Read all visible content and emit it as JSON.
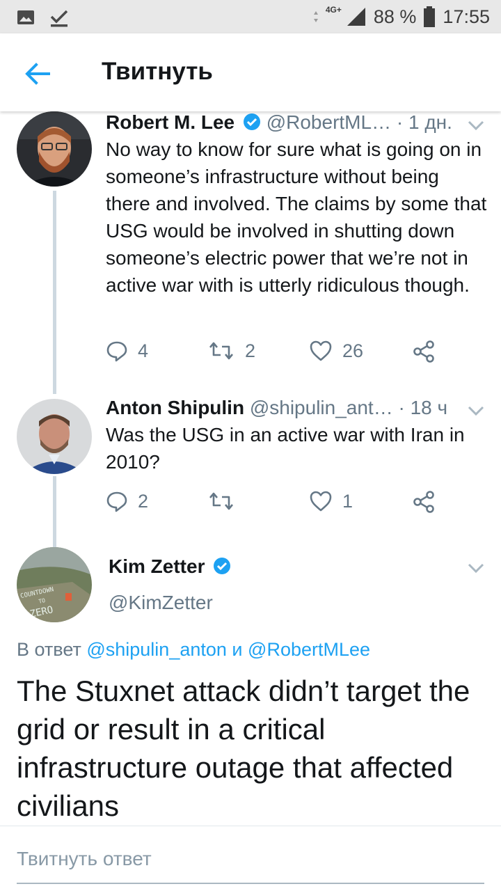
{
  "status_bar": {
    "network": "4G+",
    "battery_percent": "88 %",
    "time": "17:55",
    "icons": [
      "gallery-icon",
      "download-done-icon",
      "signal-icon",
      "battery-icon"
    ]
  },
  "app_bar": {
    "title": "Твитнуть",
    "back_icon": "arrow-left-icon"
  },
  "thread": [
    {
      "name": "Robert M. Lee",
      "verified": true,
      "handle": "@RobertML…",
      "time": "· 1 дн.",
      "text": "No way to know for sure what is going on in someone’s infrastructure without being there and involved. The claims by some that USG would be involved in shutting down someone’s electric power that we’re not in active war with is utterly ridiculous though.",
      "replies": "4",
      "retweets": "2",
      "likes": "26"
    },
    {
      "name": "Anton Shipulin",
      "verified": false,
      "handle": "@shipulin_ant…",
      "time": "· 18 ч",
      "text": "Was the USG in an active war with Iran in 2010?",
      "replies": "2",
      "retweets": "",
      "likes": "1"
    }
  ],
  "focused_tweet": {
    "name": "Kim Zetter",
    "verified": true,
    "handle": "@KimZetter",
    "avatar_text": [
      "COUNTDOWN",
      "TO",
      "ZERO"
    ],
    "reply_prefix": "В ответ",
    "reply_user_1": "@shipulin_anton",
    "reply_joiner": "и",
    "reply_user_2": "@RobertMLee",
    "text": "The Stuxnet attack didn’t target the grid or result in a critical infrastructure outage that affected civilians"
  },
  "composer": {
    "placeholder": "Твитнуть ответ"
  },
  "colors": {
    "accent": "#1da1f2",
    "muted": "#657786",
    "text": "#14171a",
    "thread_line": "#cdd8e0"
  }
}
